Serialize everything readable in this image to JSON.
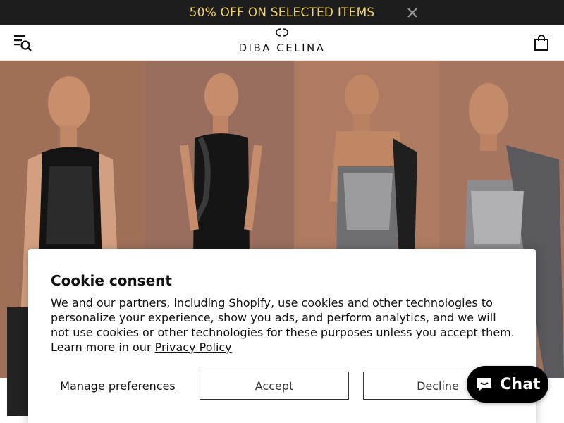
{
  "announcement": {
    "text": "50% OFF ON SELECTED ITEMS"
  },
  "header": {
    "logo_text": "DIBA CELINA"
  },
  "icons": {
    "close": "close-icon",
    "menu_search": "menu-search-icon",
    "cart": "shopping-bag-icon",
    "chat": "chat-bubble-icon"
  },
  "cookie": {
    "title": "Cookie consent",
    "body": "We and our partners, including Shopify, use cookies and other technologies to personalize your experience, show you ads, and perform analytics, and we will not use cookies or other technologies for these purposes unless you accept them. Learn more in our ",
    "privacy_link": "Privacy Policy",
    "manage_label": "Manage preferences",
    "accept_label": "Accept",
    "decline_label": "Decline"
  },
  "chat": {
    "label": "Chat"
  },
  "colors": {
    "announcement_bg": "#1d1d1d",
    "announcement_text": "#f3d36b",
    "chat_bg": "#000000"
  }
}
